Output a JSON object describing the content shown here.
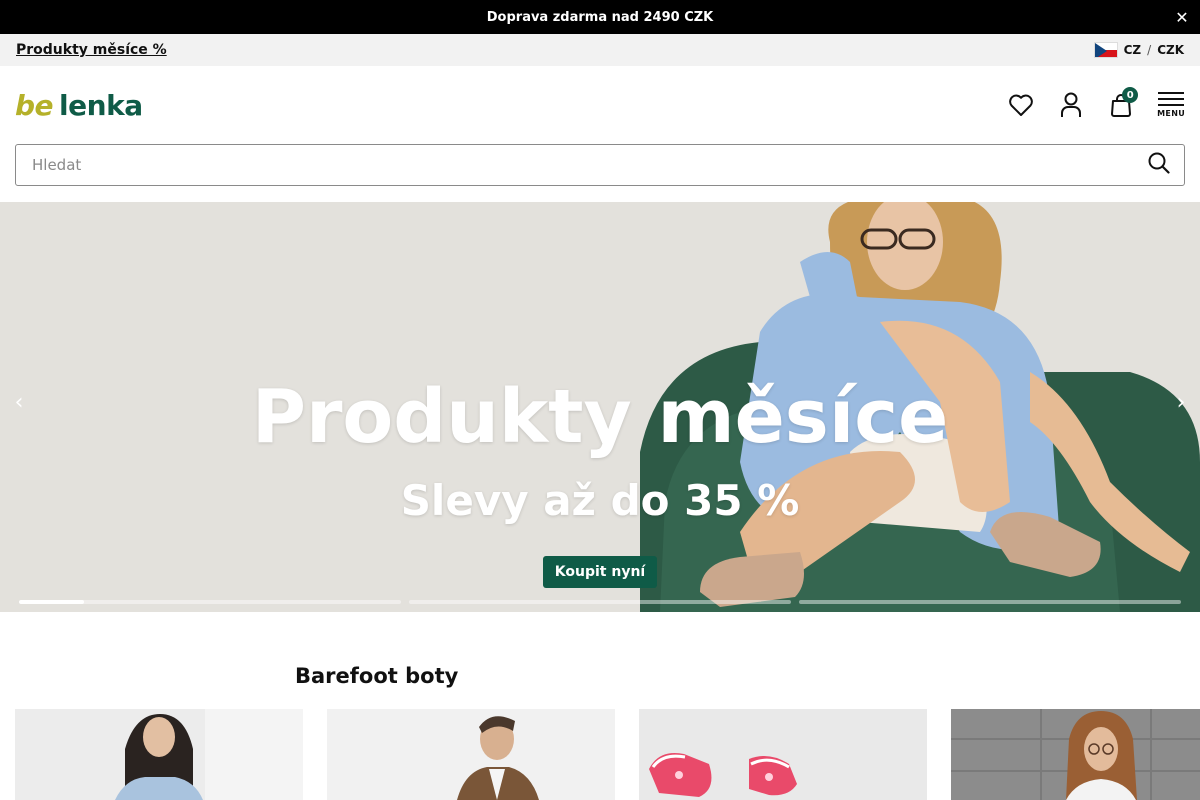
{
  "promo_bar": {
    "text": "Doprava zdarma nad 2490 CZK",
    "close_icon": "close-icon"
  },
  "sub_bar": {
    "link": "Produkty měsíce %",
    "language": "CZ",
    "separator": "/",
    "currency": "CZK",
    "flag_icon": "czech-flag-icon"
  },
  "header": {
    "logo_be": "be",
    "logo_lenka": "lenka",
    "cart_count": "0",
    "menu_label": "MENU",
    "icons": [
      "heart-icon",
      "user-icon",
      "shopping-bag-icon",
      "hamburger-menu-icon"
    ]
  },
  "search": {
    "placeholder": "Hledat",
    "value": "",
    "icon": "search-icon"
  },
  "hero": {
    "title": "Produkty měsíce",
    "subtitle": "Slevy až do 35 %",
    "cta_label": "Koupit nyní",
    "prev_icon": "chevron-left-icon",
    "next_icon": "chevron-right-icon",
    "progress": [
      0.17,
      0,
      0
    ],
    "colors": {
      "cta_bg": "#0f5b47"
    }
  },
  "section": {
    "title": "Barefoot boty",
    "cards": [
      "women-shoes-card",
      "men-shoes-card",
      "kids-shoes-card",
      "women-casual-card"
    ]
  },
  "colors": {
    "brand_green": "#0f5b47",
    "brand_olive": "#b5b12a",
    "promo_bg": "#000000",
    "sub_bar_bg": "#f2f2f2"
  }
}
